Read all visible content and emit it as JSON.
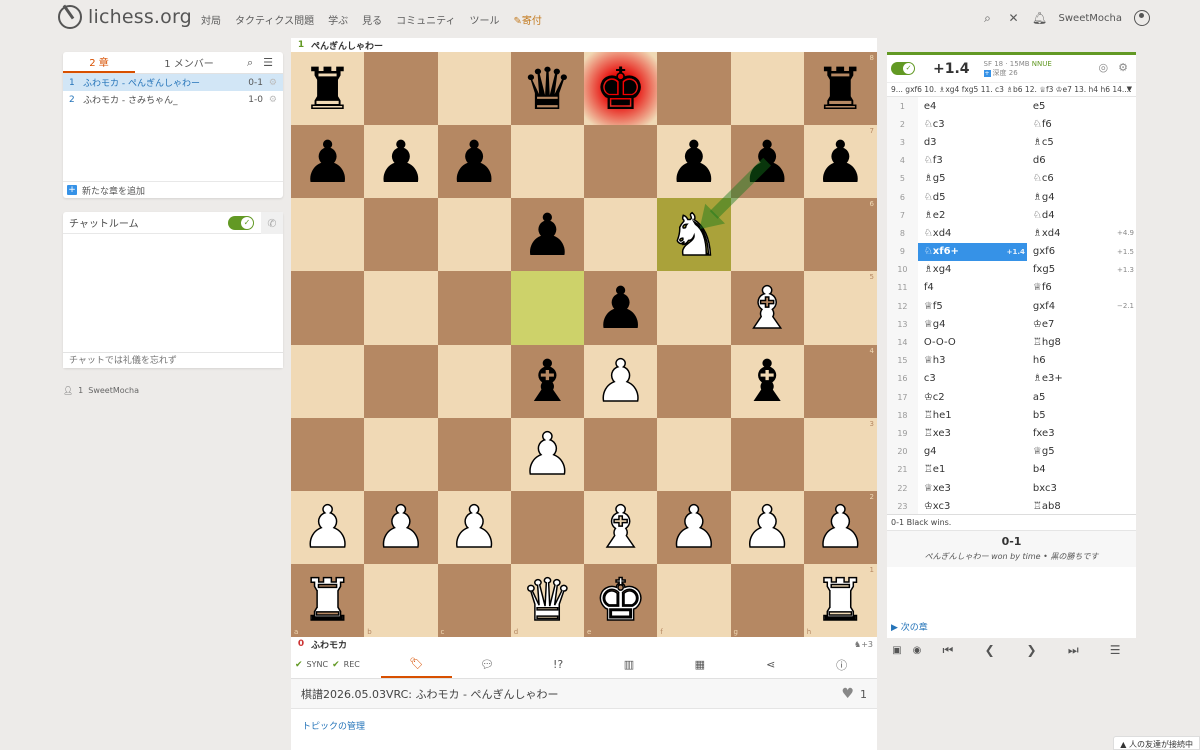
{
  "header": {
    "logo_text": "lichess.org",
    "nav": [
      "対局",
      "タクティクス問題",
      "学ぶ",
      "見る",
      "コミュニティ",
      "ツール"
    ],
    "donate": "寄付",
    "username": "SweetMocha"
  },
  "study": {
    "tab_chapters": "2 章",
    "tab_members": "1 メンバー",
    "chapters": [
      {
        "num": "1",
        "name": "ふわモカ - ぺんぎんしゃわー",
        "result": "0-1"
      },
      {
        "num": "2",
        "name": "ふわモカ - さみちゃん_",
        "result": "1-0"
      }
    ],
    "add_chapter": "新たな章を追加"
  },
  "chat": {
    "title": "チャットルーム",
    "placeholder": "チャットでは礼儀を忘れず"
  },
  "members_line": {
    "count": "1",
    "name": "SweetMocha"
  },
  "board": {
    "top_player": {
      "num": "1",
      "name": "ぺんぎんしゃわー"
    },
    "bottom_player": {
      "num": "0",
      "name": "ふわモカ",
      "extra": "+3"
    },
    "files": [
      "a",
      "b",
      "c",
      "d",
      "e",
      "f",
      "g",
      "h"
    ],
    "ranks": [
      "8",
      "7",
      "6",
      "5",
      "4",
      "3",
      "2",
      "1"
    ],
    "position": [
      [
        "bR",
        "",
        "",
        "bQ",
        "bK",
        "",
        "",
        "bR"
      ],
      [
        "bP",
        "bP",
        "bP",
        "",
        "",
        "bP",
        "bP",
        "bP"
      ],
      [
        "",
        "",
        "",
        "bP",
        "",
        "wN",
        "",
        ""
      ],
      [
        "",
        "",
        "",
        "",
        "bP",
        "",
        "wB",
        ""
      ],
      [
        "",
        "",
        "",
        "bB",
        "wP",
        "",
        "bB",
        ""
      ],
      [
        "",
        "",
        "",
        "wP",
        "",
        "",
        "",
        ""
      ],
      [
        "wP",
        "wP",
        "wP",
        "",
        "wB",
        "wP",
        "wP",
        "wP"
      ],
      [
        "wR",
        "",
        "",
        "wQ",
        "wK",
        "",
        "",
        "wR"
      ]
    ],
    "last_move": [
      "d5",
      "f6"
    ],
    "check_square": "e8",
    "arrow": {
      "from": "g7",
      "to": "f6",
      "color": "#15781B"
    }
  },
  "tools": {
    "sync": "SYNC",
    "rec": "REC",
    "items": [
      "tag-icon",
      "chat-bubble-icon",
      "!?",
      "chart-icon",
      "grid-icon",
      "share-icon",
      "info-icon"
    ]
  },
  "study_title": "棋譜2026.05.03VRC: ふわモカ - ぺんぎんしゃわー",
  "likes": "1",
  "topics": "トピックの管理",
  "ceval": {
    "score": "+1.4",
    "engine": "SF 18 · 15MB",
    "nnue": "NNUE",
    "depth": "深度 26",
    "pv": "9... gxf6 10. ♗xg4 fxg5 11. c3 ♗b6 12. ♕f3 ♔e7 13. h4 h6 14...."
  },
  "moves": [
    {
      "n": "1",
      "w": "e4",
      "b": "e5"
    },
    {
      "n": "2",
      "w": "♘c3",
      "b": "♘f6"
    },
    {
      "n": "3",
      "w": "d3",
      "b": "♗c5"
    },
    {
      "n": "4",
      "w": "♘f3",
      "b": "d6"
    },
    {
      "n": "5",
      "w": "♗g5",
      "b": "♘c6"
    },
    {
      "n": "6",
      "w": "♘d5",
      "b": "♗g4"
    },
    {
      "n": "7",
      "w": "♗e2",
      "b": "♘d4"
    },
    {
      "n": "8",
      "w": "♘xd4",
      "b": "♗xd4",
      "be": "+4.9"
    },
    {
      "n": "9",
      "w": "♘xf6+",
      "we": "+1.4",
      "b": "gxf6",
      "be": "+1.5",
      "active": true
    },
    {
      "n": "10",
      "w": "♗xg4",
      "b": "fxg5",
      "be": "+1.3"
    },
    {
      "n": "11",
      "w": "f4",
      "b": "♕f6"
    },
    {
      "n": "12",
      "w": "♕f5",
      "b": "gxf4",
      "be": "−2.1"
    },
    {
      "n": "13",
      "w": "♕g4",
      "b": "♔e7"
    },
    {
      "n": "14",
      "w": "O-O-O",
      "b": "♖hg8"
    },
    {
      "n": "15",
      "w": "♕h3",
      "b": "h6"
    },
    {
      "n": "16",
      "w": "c3",
      "b": "♗e3+"
    },
    {
      "n": "17",
      "w": "♔c2",
      "b": "a5"
    },
    {
      "n": "18",
      "w": "♖he1",
      "b": "b5"
    },
    {
      "n": "19",
      "w": "♖xe3",
      "b": "fxe3"
    },
    {
      "n": "20",
      "w": "g4",
      "b": "♕g5"
    },
    {
      "n": "21",
      "w": "♖e1",
      "b": "b4"
    },
    {
      "n": "22",
      "w": "♕xe3",
      "b": "bxc3"
    },
    {
      "n": "23",
      "w": "♔xc3",
      "b": "♖ab8"
    }
  ],
  "result": {
    "wins_text": "0-1 Black wins.",
    "score": "0-1",
    "desc": "ぺんぎんしゃわー won by time • 黒の勝ちです"
  },
  "next_chapter": "次の章",
  "friends": "人の友達が接続中",
  "colors": {
    "accent": "#629924",
    "orange": "#d85000",
    "blue": "#3692e7",
    "light_sq": "#f0d9b5",
    "dark_sq": "#b58863"
  }
}
